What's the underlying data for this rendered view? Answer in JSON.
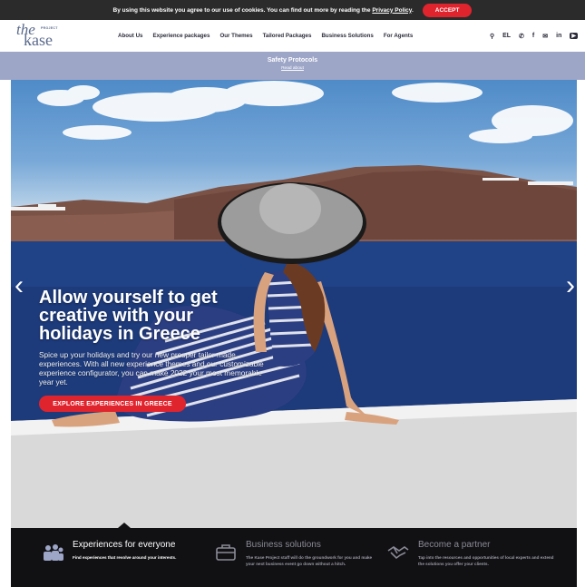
{
  "cookie": {
    "text": "By using this website you agree to our use of cookies. You can find out more by reading the",
    "link": "Privacy Policy",
    "period": ".",
    "accept": "ACCEPT"
  },
  "logo": {
    "the": "the",
    "project": "PROJECT",
    "kase": "kase"
  },
  "nav": {
    "items": [
      "About Us",
      "Experience packages",
      "Our Themes",
      "Tailored Packages",
      "Business Solutions",
      "For Agents"
    ]
  },
  "header_icons": {
    "language": "EL",
    "search_glyph": "⚲",
    "phone_glyph": "✆",
    "facebook_glyph": "f",
    "email_glyph": "✉",
    "linkedin_glyph": "in",
    "youtube_glyph": "▶"
  },
  "safety": {
    "title": "Safety Protocols",
    "link": "Read about"
  },
  "hero": {
    "title_lines": [
      "Allow yourself to get",
      "creative with your",
      "holidays in Greece"
    ],
    "subtitle": "Spice up your holidays and try our new prosper tailor made experiences. With all new experience themes and our customizable experience configurator, you can make 2022 your most memorable year yet.",
    "button": "EXPLORE EXPERIENCES IN GREECE",
    "prev_glyph": "‹",
    "next_glyph": "›"
  },
  "features": [
    {
      "title": "Experiences for everyone",
      "desc": "Find experiences that revolve around your interests.",
      "icon": "group-icon"
    },
    {
      "title": "Business solutions",
      "desc": "The Kase Project staff will do the groundwork for you and make your next business event go down without a hitch.",
      "icon": "briefcase-icon"
    },
    {
      "title": "Become a partner",
      "desc": "Tap into the resources and opportunities of local experts and extend the solutions you offer your clients.",
      "icon": "handshake-icon"
    }
  ],
  "colors": {
    "accent": "#e0242e",
    "safety_bar": "#9ea6c8",
    "dark": "#111114"
  }
}
